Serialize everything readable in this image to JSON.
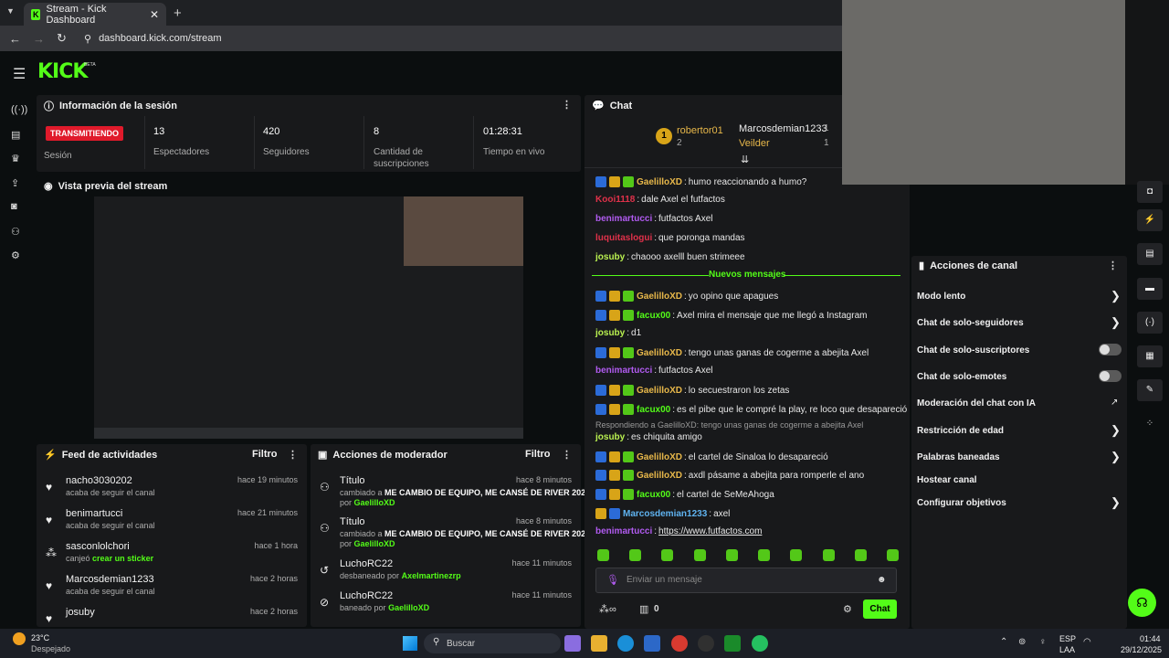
{
  "browser": {
    "tab_title": "Stream - Kick Dashboard",
    "url": "dashboard.kick.com/stream"
  },
  "brand": {
    "logo": "KICK",
    "beta": "BETA"
  },
  "session": {
    "title": "Información de la sesión",
    "live_badge": "TRANSMITIENDO",
    "live_label": "Sesión",
    "stats": [
      {
        "value": "13",
        "label": "Espectadores"
      },
      {
        "value": "420",
        "label": "Seguidores"
      },
      {
        "value": "8",
        "label": "Cantidad de suscripciones"
      },
      {
        "value": "01:28:31",
        "label": "Tiempo en vivo"
      }
    ]
  },
  "preview": {
    "title": "Vista previa del stream"
  },
  "feed": {
    "title": "Feed de actividades",
    "filter": "Filtro",
    "items": [
      {
        "name": "nacho3030202",
        "sub": "acaba de seguir el canal",
        "time": "hace 19 minutos",
        "icon": "heart-icon"
      },
      {
        "name": "benimartucci",
        "sub": "acaba de seguir el canal",
        "time": "hace 21 minutos",
        "icon": "heart-icon"
      },
      {
        "name": "sasconlolchori",
        "sub": "canjeó",
        "sub2": "crear un sticker",
        "time": "hace 1 hora",
        "icon": "redeem-icon"
      },
      {
        "name": "Marcosdemian1233",
        "sub": "acaba de seguir el canal",
        "time": "hace 2 horas",
        "icon": "heart-icon"
      },
      {
        "name": "josuby",
        "sub": "",
        "time": "hace 2 horas",
        "icon": "heart-icon"
      }
    ]
  },
  "mod": {
    "title": "Acciones de moderador",
    "filter": "Filtro",
    "items": [
      {
        "name": "Título",
        "time": "hace 8 minutos",
        "line1": "cambiado a",
        "bold": "ME CAMBIO DE EQUIPO, ME CANSÉ DE RIVER 2025",
        "by": "por",
        "user": "GaelilloXD"
      },
      {
        "name": "Título",
        "time": "hace 8 minutos",
        "line1": "cambiado a",
        "bold": "ME CAMBIO DE EQUIPO, ME CANSÉ DE RIVER 2025",
        "by": "por",
        "user": "GaelilloXD"
      },
      {
        "name": "LuchoRC22",
        "time": "hace 11 minutos",
        "line1": "desbaneado por",
        "user": "Axelmartinezrp"
      },
      {
        "name": "LuchoRC22",
        "time": "hace 11 minutos",
        "line1": "baneado por",
        "user": "GaelilloXD"
      }
    ]
  },
  "chat": {
    "title": "Chat",
    "top": [
      {
        "rank": "1",
        "name": "robertor01",
        "count": "2"
      },
      {
        "name": "Marcosdemian1233",
        "count": "1"
      },
      {
        "name": "Veilder",
        "count": "1"
      }
    ],
    "new_messages": "Nuevos mensajes",
    "reply_note": "Respondiendo a GaelilloXD: tengo unas ganas de cogerme a abejita Axel",
    "messages": [
      {
        "user": "GaelilloXD",
        "color": "#e8b84a",
        "text": "humo reaccionando a humo?",
        "badges": 3
      },
      {
        "user": "Kooi1118",
        "color": "#e0314a",
        "text": "dale Axel el futfactos",
        "badges": 0
      },
      {
        "user": "benimartucci",
        "color": "#b15bf0",
        "text": "futfactos Axel",
        "badges": 0
      },
      {
        "user": "luquitaslogui",
        "color": "#e0314a",
        "text": "que poronga mandas",
        "badges": 0
      },
      {
        "user": "josuby",
        "color": "#b9f050",
        "text": "chaooo axelll buen strimeee",
        "badges": 0
      },
      {
        "user": "GaelilloXD",
        "color": "#e8b84a",
        "text": "yo opino que apagues",
        "badges": 3
      },
      {
        "user": "facux00",
        "color": "#53fc18",
        "text": "Axel mira el mensaje que me llegó a Instagram",
        "badges": 3
      },
      {
        "user": "josuby",
        "color": "#b9f050",
        "text": "d1",
        "badges": 0
      },
      {
        "user": "GaelilloXD",
        "color": "#e8b84a",
        "text": "tengo unas ganas de cogerme a abejita Axel",
        "badges": 3
      },
      {
        "user": "benimartucci",
        "color": "#b15bf0",
        "text": "futfactos Axel",
        "badges": 0
      },
      {
        "user": "GaelilloXD",
        "color": "#e8b84a",
        "text": "lo secuestraron los zetas",
        "badges": 3
      },
      {
        "user": "facux00",
        "color": "#53fc18",
        "text": "es el pibe que le compré la play, re loco que desapareció",
        "badges": 3
      },
      {
        "user": "josuby",
        "color": "#b9f050",
        "text": "es chiquita amigo",
        "badges": 0
      },
      {
        "user": "GaelilloXD",
        "color": "#e8b84a",
        "text": "el cartel de Sinaloa lo desapareció",
        "badges": 3
      },
      {
        "user": "GaelilloXD",
        "color": "#e8b84a",
        "text": "axdl pásame a abejita para romperle el ano",
        "badges": 3
      },
      {
        "user": "facux00",
        "color": "#53fc18",
        "text": "el cartel de SeMeAhoga",
        "badges": 3
      },
      {
        "user": "Marcosdemian1233",
        "color": "#5fb3f0",
        "text": "axel",
        "badges": 2
      },
      {
        "user": "benimartucci",
        "color": "#b15bf0",
        "text": "https://www.futfactos.com",
        "badges": 0
      }
    ],
    "placeholder": "Enviar un mensaje",
    "send": "Chat",
    "count": "0"
  },
  "channel": {
    "title": "Acciones de canal",
    "items": [
      {
        "label": "Modo lento",
        "ctl": "chevron"
      },
      {
        "label": "Chat de solo-seguidores",
        "ctl": "chevron"
      },
      {
        "label": "Chat de solo-suscriptores",
        "ctl": "toggle"
      },
      {
        "label": "Chat de solo-emotes",
        "ctl": "toggle"
      },
      {
        "label": "Moderación del chat con IA",
        "ctl": "ext"
      },
      {
        "label": "Restricción de edad",
        "ctl": "chevron"
      },
      {
        "label": "Palabras baneadas",
        "ctl": "chevron"
      },
      {
        "label": "Hostear canal",
        "ctl": "none"
      },
      {
        "label": "Configurar objetivos",
        "ctl": "chevron"
      }
    ]
  },
  "taskbar": {
    "weather": "23°C",
    "weather_sub": "Despejado",
    "search": "Buscar",
    "lang": "ESP",
    "lang2": "LAA",
    "time": "01:44",
    "date": "29/12/2025"
  }
}
